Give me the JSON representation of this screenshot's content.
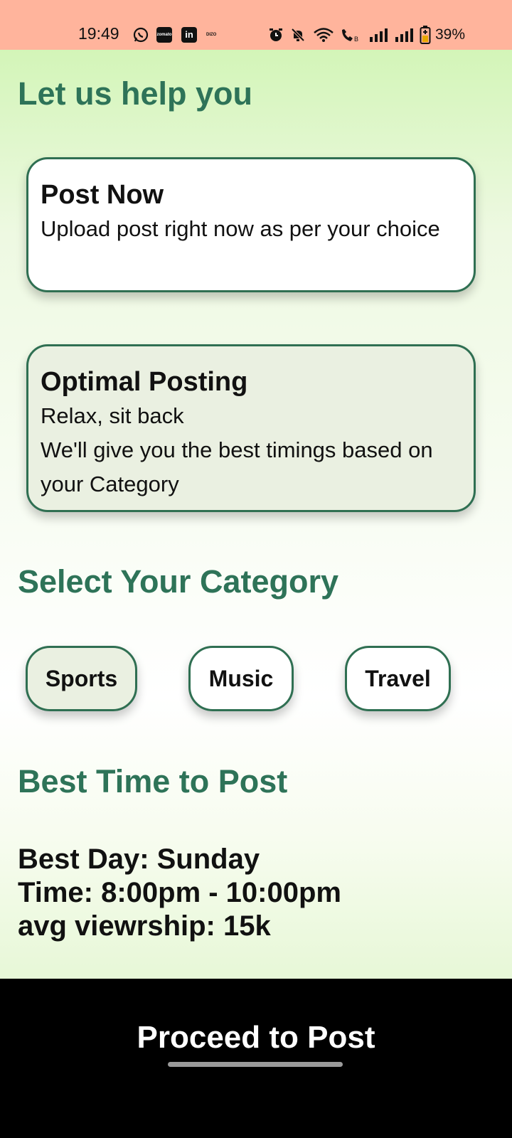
{
  "status_bar": {
    "time": "19:49",
    "battery": "39%",
    "notification_icons": [
      "whatsapp-icon",
      "app-icon",
      "linkedin-icon",
      "dizo-icon"
    ],
    "system_icons": [
      "alarm-icon",
      "mute-icon",
      "wifi-icon",
      "call-icon",
      "signal-icon",
      "signal-icon",
      "battery-icon"
    ],
    "app_icon_text": "zomato",
    "linkedin_text": "in",
    "dizo_text": "DIZO"
  },
  "page": {
    "heading": "Let us help you"
  },
  "options": [
    {
      "title": "Post Now",
      "description": "Upload post right now as per your choice",
      "selected": false
    },
    {
      "title": "Optimal Posting",
      "description": "Relax, sit back\nWe'll give you the best timings based on your Category",
      "selected": true
    }
  ],
  "category": {
    "heading": "Select Your Category",
    "chips": [
      {
        "label": "Sports",
        "selected": true
      },
      {
        "label": "Music",
        "selected": false
      },
      {
        "label": "Travel",
        "selected": false
      }
    ]
  },
  "best_time": {
    "heading": "Best Time to Post",
    "day_line": "Best Day: Sunday",
    "time_line": "Time: 8:00pm - 10:00pm",
    "viewership_line": "avg viewrship: 15k"
  },
  "footer": {
    "proceed_label": "Proceed to Post"
  },
  "colors": {
    "accent_green": "#2e7358",
    "selected_fill": "#eaf0e1",
    "unselected_fill": "#ffffff",
    "status_bar": "#ffb49c",
    "footer": "#000000"
  }
}
